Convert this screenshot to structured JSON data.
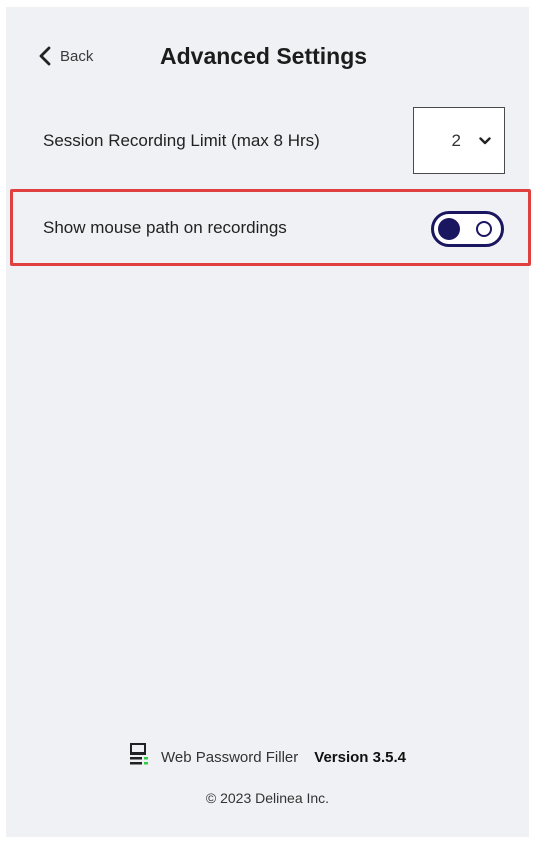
{
  "header": {
    "back_label": "Back",
    "title": "Advanced Settings"
  },
  "settings": {
    "recording_limit": {
      "label": "Session Recording Limit (max 8 Hrs)",
      "value": "2"
    },
    "mouse_path": {
      "label": "Show mouse path on recordings",
      "enabled": true
    }
  },
  "footer": {
    "product_name": "Web Password Filler",
    "version": "Version 3.5.4",
    "copyright": "© 2023 Delinea Inc.",
    "logo_icon": "password-filler-logo-icon"
  },
  "colors": {
    "toggle": "#1b1660",
    "highlight": "#e04040",
    "background": "#f0f1f5",
    "logo_green": "#2ecc40"
  }
}
